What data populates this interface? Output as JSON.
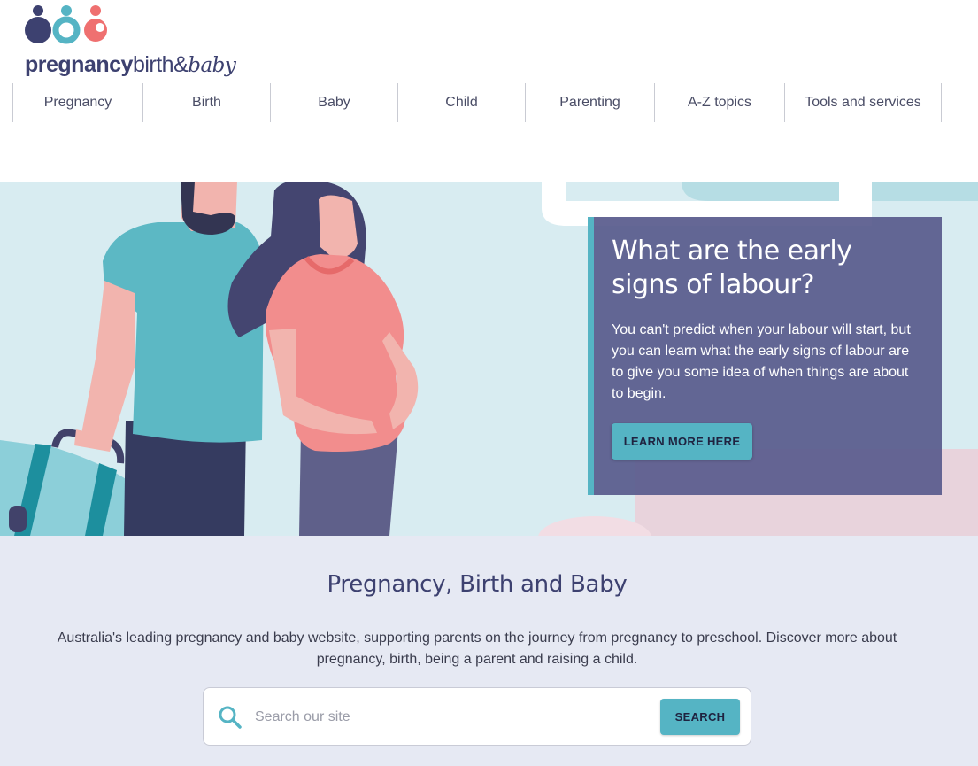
{
  "logo": {
    "part1": "pregnancy",
    "part2": "birth&",
    "part3": "baby",
    "colors": [
      "#3d4170",
      "#55b4c4",
      "#ef7070"
    ]
  },
  "nav": {
    "items": [
      {
        "label": "Pregnancy"
      },
      {
        "label": "Birth"
      },
      {
        "label": "Baby"
      },
      {
        "label": "Child"
      },
      {
        "label": "Parenting"
      },
      {
        "label": "A-Z topics"
      },
      {
        "label": "Tools and services"
      }
    ]
  },
  "hero": {
    "title": "What are the early signs of labour?",
    "body": "You can't predict when your labour will start, but you can learn what the early signs of labour are to give you some idea of when things are about to begin.",
    "button_label": "LEARN MORE HERE"
  },
  "intro": {
    "title": "Pregnancy, Birth and Baby",
    "description": "Australia's leading pregnancy and baby website, supporting parents on the journey from pregnancy to preschool. Discover more about pregnancy, birth, being a parent and raising a child."
  },
  "search": {
    "placeholder": "Search our site",
    "button_label": "SEARCH",
    "icon": "search-icon"
  },
  "colors": {
    "brand": "#3d4170",
    "accent": "#55b4c4",
    "coral": "#ef7070",
    "hero_bg": "#d8ecf1",
    "intro_bg": "#e6e9f3"
  }
}
